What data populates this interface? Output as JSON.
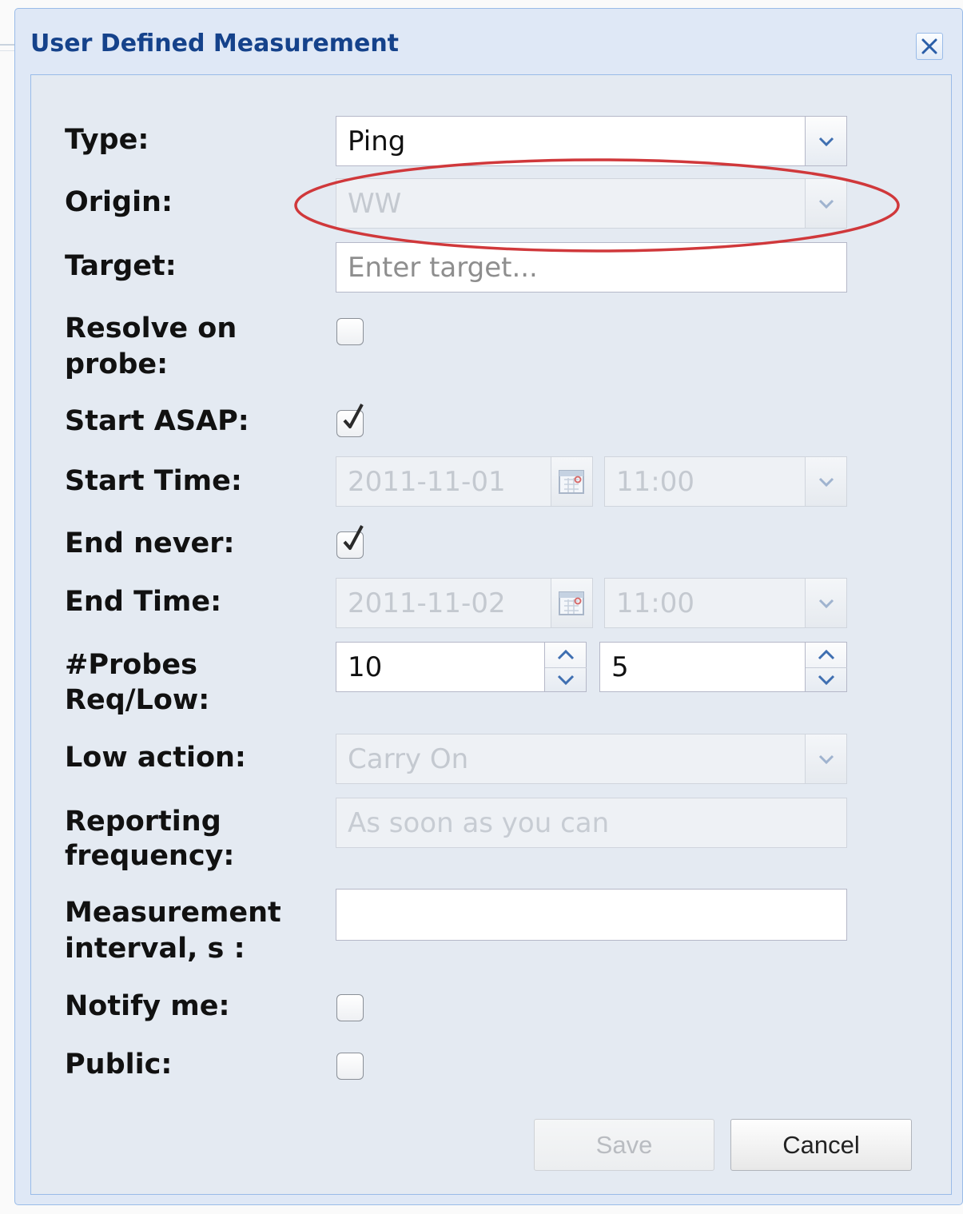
{
  "dialog": {
    "title": "User Defined Measurement"
  },
  "labels": {
    "type": "Type:",
    "origin": "Origin:",
    "target": "Target:",
    "resolve_line1": "Resolve on",
    "resolve_line2": "probe:",
    "start_asap": "Start ASAP:",
    "start_time": "Start Time:",
    "end_never": "End never:",
    "end_time": "End Time:",
    "probes_line1": "#Probes",
    "probes_line2": "Req/Low:",
    "low_action": "Low action:",
    "reporting_line1": "Reporting",
    "reporting_line2": "frequency:",
    "interval_line1": "Measurement",
    "interval_line2": "interval, s :",
    "notify_me": "Notify me:",
    "public": "Public:"
  },
  "fields": {
    "type": {
      "value": "Ping"
    },
    "origin": {
      "value": "WW",
      "disabled": true
    },
    "target": {
      "value": "",
      "placeholder": "Enter target..."
    },
    "resolve_on_probe": {
      "checked": false
    },
    "start_asap": {
      "checked": true
    },
    "start_date": {
      "value": "2011-11-01",
      "disabled": true
    },
    "start_hour": {
      "value": "11:00",
      "disabled": true
    },
    "end_never": {
      "checked": true
    },
    "end_date": {
      "value": "2011-11-02",
      "disabled": true
    },
    "end_hour": {
      "value": "11:00",
      "disabled": true
    },
    "probes_requested": {
      "value": "10"
    },
    "probes_low": {
      "value": "5"
    },
    "low_action": {
      "value": "Carry On",
      "disabled": true
    },
    "reporting_frequency": {
      "placeholder": "As soon as you can",
      "disabled": true
    },
    "measurement_interval": {
      "value": ""
    },
    "notify_me": {
      "checked": false
    },
    "public": {
      "checked": false
    }
  },
  "buttons": {
    "save": {
      "label": "Save",
      "disabled": true
    },
    "cancel": {
      "label": "Cancel"
    }
  },
  "annotation": {
    "shape": "oval",
    "color": "#d0383b",
    "target": "origin"
  },
  "colors": {
    "title": "#15428b",
    "window_bg": "#dfe8f6",
    "border": "#99bbe8"
  }
}
